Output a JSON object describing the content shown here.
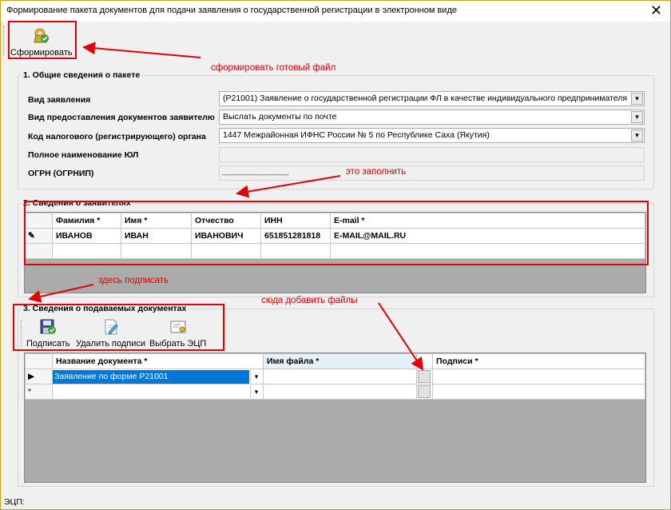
{
  "window": {
    "title": "Формирование пакета документов для подачи заявления о государственной регистрации в электронном виде"
  },
  "toolbar": {
    "form_label": "Сформировать"
  },
  "section1": {
    "title": "1. Общие сведения о пакете",
    "fields": {
      "application_type_label": "Вид заявления",
      "application_type_value": "(P21001) Заявление о государственной регистрации ФЛ в качестве индивидуального предпринимателя",
      "delivery_label": "Вид предоставления документов заявителю",
      "delivery_value": "Выслать документы по почте",
      "tax_code_label": "Код налогового (регистрирующего) органа",
      "tax_code_value": "1447 Межрайонная ИФНС России № 5 по Республике Саха (Якутия)",
      "full_name_label": "Полное наименование ЮЛ",
      "ogrn_label": "ОГРН (ОГРНИП)",
      "ogrn_mask": "_______________"
    }
  },
  "section2": {
    "title": "2. Сведения о заявителях",
    "columns": [
      "Фамилия *",
      "Имя *",
      "Отчество",
      "ИНН",
      "E-mail *"
    ],
    "rows": [
      {
        "last_name": "ИВАНОВ",
        "first_name": "ИВАН",
        "middle_name": "ИВАНОВИЧ",
        "inn": "651851281818",
        "email": "E-MAIL@MAIL.RU"
      }
    ]
  },
  "section3": {
    "title": "3. Сведения о подаваемых документах",
    "buttons": {
      "sign": "Подписать",
      "remove_signatures": "Удалить подписи",
      "choose_key": "Выбрать ЭЦП"
    },
    "columns": {
      "doc_name": "Название документа *",
      "file_name": "Имя файла *",
      "signatures": "Подписи *"
    },
    "rows": [
      {
        "doc_name": "Заявление по форме Р21001",
        "file_name": "",
        "signatures": ""
      }
    ]
  },
  "status": {
    "label": "ЭЦП:"
  },
  "annotations": {
    "form_file": "сформировать готовый файл",
    "fill_this": "это заполнить",
    "sign_here": "здесь подписать",
    "add_files_here": "сюда добавить файлы"
  },
  "colors": {
    "annotation": "#e00000",
    "selection": "#0078d7"
  }
}
